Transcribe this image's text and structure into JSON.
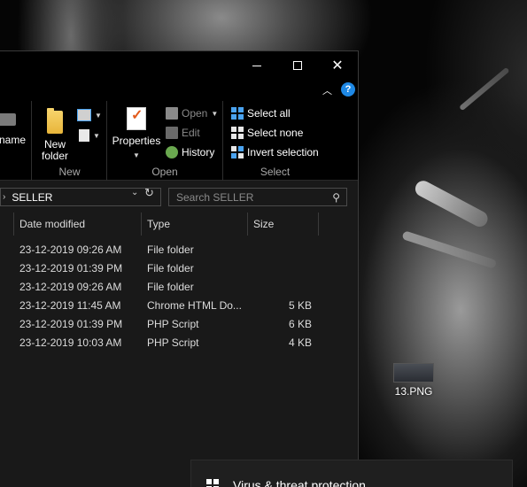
{
  "window": {
    "controls": {
      "minimize_icon": "minimize-icon",
      "maximize_icon": "maximize-icon",
      "close_icon": "close-icon"
    }
  },
  "ribbon": {
    "help_label": "?",
    "partial_button_label": "name",
    "new_group": {
      "label": "New",
      "new_folder_label_line1": "New",
      "new_folder_label_line2": "folder"
    },
    "open_group": {
      "label": "Open",
      "properties_label": "Properties",
      "open_label": "Open",
      "edit_label": "Edit",
      "history_label": "History"
    },
    "select_group": {
      "label": "Select",
      "select_all_label": "Select all",
      "select_none_label": "Select none",
      "invert_selection_label": "Invert selection"
    }
  },
  "address": {
    "current_folder": "SELLER",
    "search_placeholder": "Search SELLER"
  },
  "file_list": {
    "columns": {
      "date_modified": "Date modified",
      "type": "Type",
      "size": "Size"
    },
    "rows": [
      {
        "date": "23-12-2019 09:26 AM",
        "type": "File folder",
        "size": ""
      },
      {
        "date": "23-12-2019 01:39 PM",
        "type": "File folder",
        "size": ""
      },
      {
        "date": "23-12-2019 09:26 AM",
        "type": "File folder",
        "size": ""
      },
      {
        "date": "23-12-2019 11:45 AM",
        "type": "Chrome HTML Do...",
        "size": "5 KB"
      },
      {
        "date": "23-12-2019 01:39 PM",
        "type": "PHP Script",
        "size": "6 KB"
      },
      {
        "date": "23-12-2019 10:03 AM",
        "type": "PHP Script",
        "size": "4 KB"
      }
    ]
  },
  "desktop": {
    "icon_label": "13.PNG"
  },
  "notification": {
    "title": "Virus & threat protection"
  },
  "colors": {
    "window_bg": "#191919",
    "ribbon_bg": "#000000",
    "accent": "#1e88e5",
    "select_icon_blue": "#4aa3f0",
    "folder_yellow": "#f6d36a"
  }
}
